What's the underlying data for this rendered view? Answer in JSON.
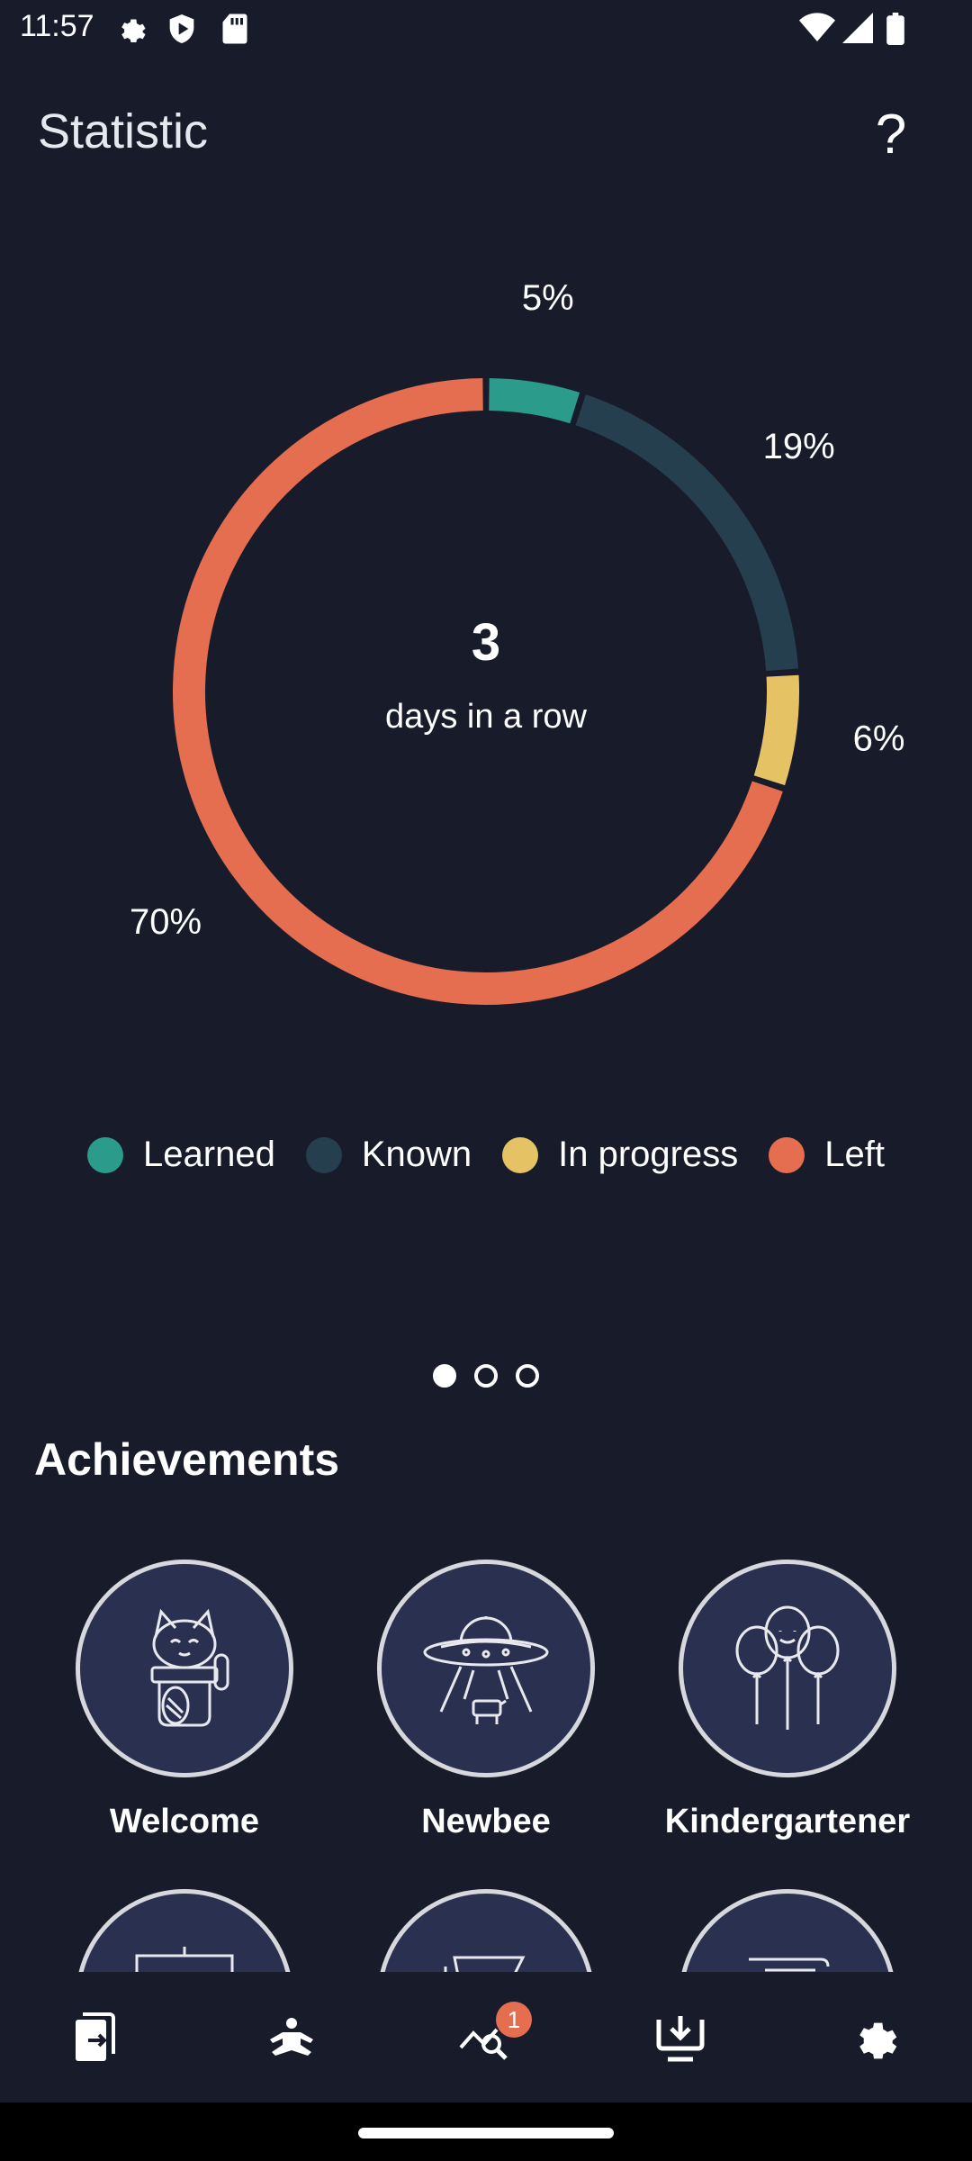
{
  "status_bar": {
    "time": "11:57"
  },
  "header": {
    "title": "Statistic",
    "help_label": "?"
  },
  "chart_data": {
    "type": "pie",
    "categories": [
      "Learned",
      "Known",
      "In progress",
      "Left"
    ],
    "values": [
      5,
      19,
      6,
      70
    ],
    "labels": [
      "5%",
      "19%",
      "6%",
      "70%"
    ],
    "colors": [
      "#2b9c8b",
      "#253f4f",
      "#e5c365",
      "#e56e51"
    ],
    "legend_position": "bottom",
    "center_value": "3",
    "center_label": "days in a row"
  },
  "pager": {
    "count": 3,
    "active": 0
  },
  "achievements": {
    "title": "Achievements",
    "items": [
      {
        "label": "Welcome",
        "icon": "lucky-cat-icon"
      },
      {
        "label": "Newbee",
        "icon": "ufo-icon"
      },
      {
        "label": "Kindergartener",
        "icon": "balloons-icon"
      },
      {
        "label": "",
        "icon": "board-icon"
      },
      {
        "label": "",
        "icon": "desk-icon"
      },
      {
        "label": "",
        "icon": "document-icon"
      }
    ]
  },
  "bottom_nav": {
    "items": [
      {
        "icon": "cards-icon"
      },
      {
        "icon": "meditation-icon"
      },
      {
        "icon": "statistics-icon",
        "badge": "1"
      },
      {
        "icon": "download-icon"
      },
      {
        "icon": "settings-icon"
      }
    ]
  }
}
